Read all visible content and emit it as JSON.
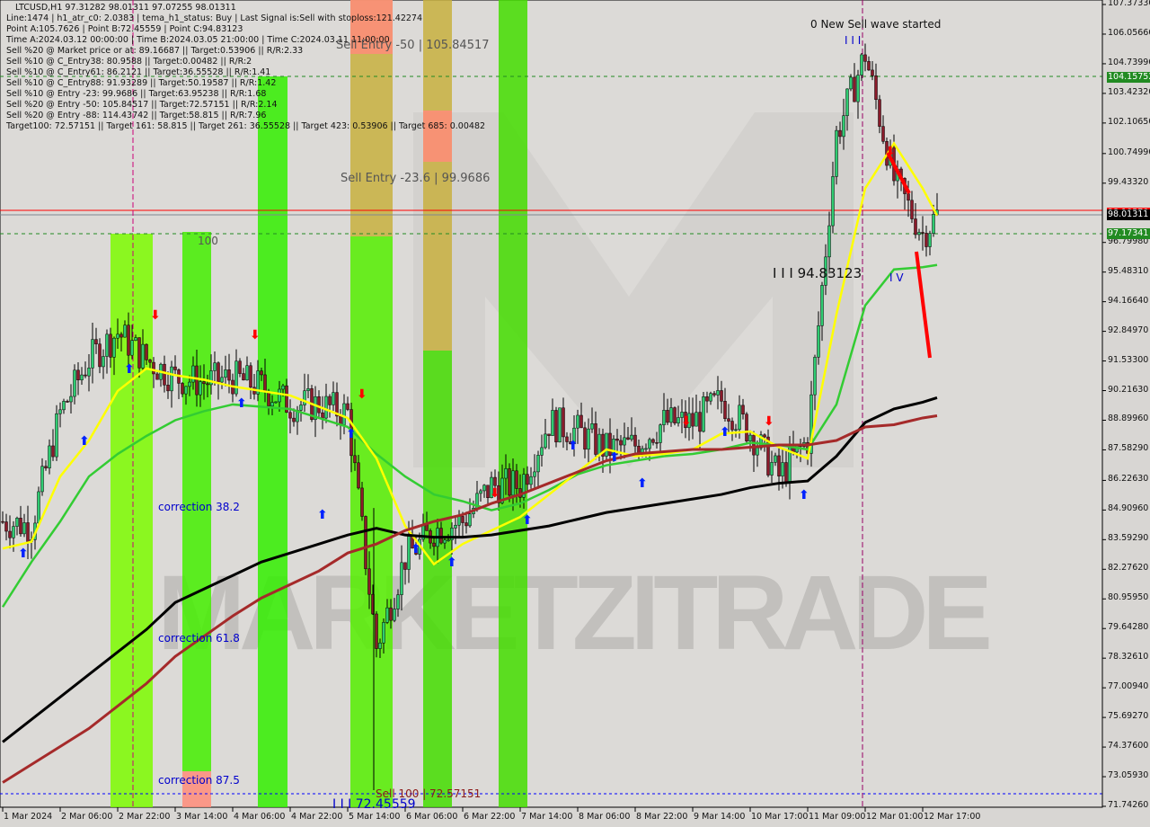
{
  "header": {
    "title": "LTCUSD,H1  97.31282 98.01311 97.07255 98.01311",
    "lines": [
      "Line:1474 | h1_atr_c0: 2.0383 | tema_h1_status: Buy | Last Signal is:Sell with stoploss:121.42274",
      "Point A:105.7626 | Point B:72.45559 | Point C:94.83123",
      "Time A:2024.03.12 00:00:00 | Time B:2024.03.05 21:00:00 | Time C:2024.03.11 11:00:00",
      "Sell %20 @ Market price or at: 89.16687 || Target:0.53906 || R/R:2.33",
      "Sell %10 @ C_Entry38: 80.9588 || Target:0.00482 || R/R:2",
      "Sell %10 @ C_Entry61: 86.2121 || Target:36.55528 || R/R:1.41",
      "Sell %10 @ C_Entry88: 91.93289 || Target:50.19587 || R/R:1.42",
      "Sell %10 @ Entry -23: 99.9686 || Target:63.95238 || R/R:1.68",
      "Sell %20 @ Entry -50: 105.84517 || Target:72.57151 || R/R:2.14",
      "Sell %20 @ Entry -88: 114.43742 || Target:58.815 || R/R:7.96",
      "Target100: 72.57151 || Target 161: 58.815 || Target 261: 36.55528 || Target 423: 0.53906 || Target 685: 0.00482"
    ]
  },
  "chart_data": {
    "type": "candlestick",
    "symbol": "LTCUSD",
    "timeframe": "H1",
    "ylim": [
      71.7426,
      107.3733
    ],
    "y_ticks": [
      "107.37330",
      "106.05660",
      "104.73990",
      "103.42320",
      "102.10650",
      "100.74990",
      "99.43320",
      "96.79980",
      "95.48310",
      "94.16640",
      "92.84970",
      "91.53300",
      "90.21630",
      "88.89960",
      "87.58290",
      "86.22630",
      "84.90960",
      "83.59290",
      "82.27620",
      "80.95950",
      "79.64280",
      "78.32610",
      "77.00940",
      "75.69270",
      "74.37600",
      "73.05930",
      "71.74260"
    ],
    "x_ticks": [
      "1 Mar 2024",
      "2 Mar 06:00",
      "2 Mar 22:00",
      "3 Mar 14:00",
      "4 Mar 06:00",
      "4 Mar 22:00",
      "5 Mar 14:00",
      "6 Mar 06:00",
      "6 Mar 22:00",
      "7 Mar 14:00",
      "8 Mar 06:00",
      "8 Mar 22:00",
      "9 Mar 14:00",
      "10 Mar 17:00",
      "11 Mar 09:00",
      "12 Mar 01:00",
      "12 Mar 17:00"
    ],
    "sample_times": [
      "1 Mar 14:00",
      "1 Mar 22:00",
      "2 Mar 06:00",
      "2 Mar 14:00",
      "2 Mar 22:00",
      "3 Mar 06:00",
      "3 Mar 14:00",
      "3 Mar 22:00",
      "4 Mar 06:00",
      "4 Mar 14:00",
      "4 Mar 22:00",
      "5 Mar 06:00",
      "5 Mar 14:00",
      "5 Mar 22:00",
      "6 Mar 06:00",
      "6 Mar 14:00",
      "6 Mar 22:00",
      "7 Mar 06:00",
      "7 Mar 14:00",
      "7 Mar 22:00",
      "8 Mar 06:00",
      "8 Mar 14:00",
      "8 Mar 22:00",
      "9 Mar 06:00",
      "9 Mar 14:00",
      "9 Mar 22:00",
      "10 Mar 17:00",
      "11 Mar 01:00",
      "11 Mar 09:00",
      "11 Mar 17:00",
      "12 Mar 01:00",
      "12 Mar 09:00",
      "12 Mar 17:00",
      "12 Mar 21:00"
    ],
    "close": [
      84.4,
      84.2,
      89.2,
      91.59,
      92.79,
      91.59,
      90.79,
      90.59,
      90.79,
      90.39,
      89.59,
      89.59,
      89.2,
      78.81,
      82.8,
      84.0,
      84.4,
      86.0,
      86.0,
      88.8,
      88.4,
      87.6,
      87.8,
      88.8,
      88.8,
      89.79,
      88.4,
      86.4,
      88.0,
      101.58,
      105.18,
      99.58,
      97.19,
      98.01
    ],
    "series": [
      {
        "color": "#33cc33",
        "values": [
          80.6,
          82.6,
          84.4,
          86.4,
          87.4,
          88.2,
          88.9,
          89.3,
          89.6,
          89.5,
          89.4,
          89.0,
          88.6,
          87.4,
          86.4,
          85.6,
          85.3,
          84.9,
          85.2,
          85.8,
          86.5,
          86.9,
          87.1,
          87.3,
          87.4,
          87.6,
          87.9,
          87.8,
          87.6,
          89.6,
          94.0,
          95.6,
          95.7,
          95.8
        ]
      },
      {
        "color": "#ffff00",
        "values": [
          83.2,
          83.5,
          86.4,
          88.0,
          90.2,
          91.2,
          90.9,
          90.7,
          90.4,
          90.2,
          90.0,
          89.5,
          89.0,
          87.2,
          84.2,
          82.5,
          83.4,
          84.0,
          84.6,
          85.6,
          86.6,
          87.6,
          87.3,
          87.4,
          87.6,
          88.3,
          88.4,
          87.7,
          87.2,
          93.6,
          99.2,
          101.2,
          99.2,
          98.0
        ]
      },
      {
        "color": "#000000",
        "values": [
          74.6,
          75.6,
          76.6,
          77.6,
          78.6,
          79.6,
          80.8,
          81.4,
          82.0,
          82.6,
          83.0,
          83.4,
          83.8,
          84.1,
          83.8,
          83.7,
          83.7,
          83.8,
          84.0,
          84.2,
          84.5,
          84.8,
          85.0,
          85.2,
          85.4,
          85.6,
          85.9,
          86.1,
          86.2,
          87.3,
          88.8,
          89.4,
          89.7,
          89.9
        ]
      },
      {
        "color": "#a52a2a",
        "values": [
          72.8,
          73.6,
          74.4,
          75.2,
          76.2,
          77.2,
          78.4,
          79.3,
          80.2,
          81.0,
          81.6,
          82.2,
          83.0,
          83.4,
          84.0,
          84.4,
          84.7,
          85.2,
          85.6,
          86.1,
          86.6,
          87.1,
          87.4,
          87.5,
          87.6,
          87.6,
          87.7,
          87.8,
          87.8,
          88.0,
          88.6,
          88.7,
          89.0,
          89.1
        ]
      }
    ],
    "price_tags": [
      {
        "value": "104.15752",
        "color": "#228b22"
      },
      {
        "value": "98.10570",
        "color": "#ff0000"
      },
      {
        "value": "98.01311",
        "color": "#000000"
      },
      {
        "value": "97.17341",
        "color": "#228b22"
      }
    ],
    "annotations": {
      "sell_entry_50": "Sell Entry -50 | 105.84517",
      "sell_entry_236": "Sell Entry -23.6 | 99.9686",
      "level_100": "100",
      "correction_382": "correction 38.2",
      "correction_618": "correction 61.8",
      "correction_875": "correction 87.5",
      "sell_100": "Sell 100 | 72.57151",
      "point_b": "I I I 72.45559",
      "point_c": "I I I 94.83123",
      "new_wave": "0 New Sell wave started",
      "point_a": "I I I",
      "wave_iv": "I V"
    },
    "watermark": "MARKETZITRADE"
  }
}
